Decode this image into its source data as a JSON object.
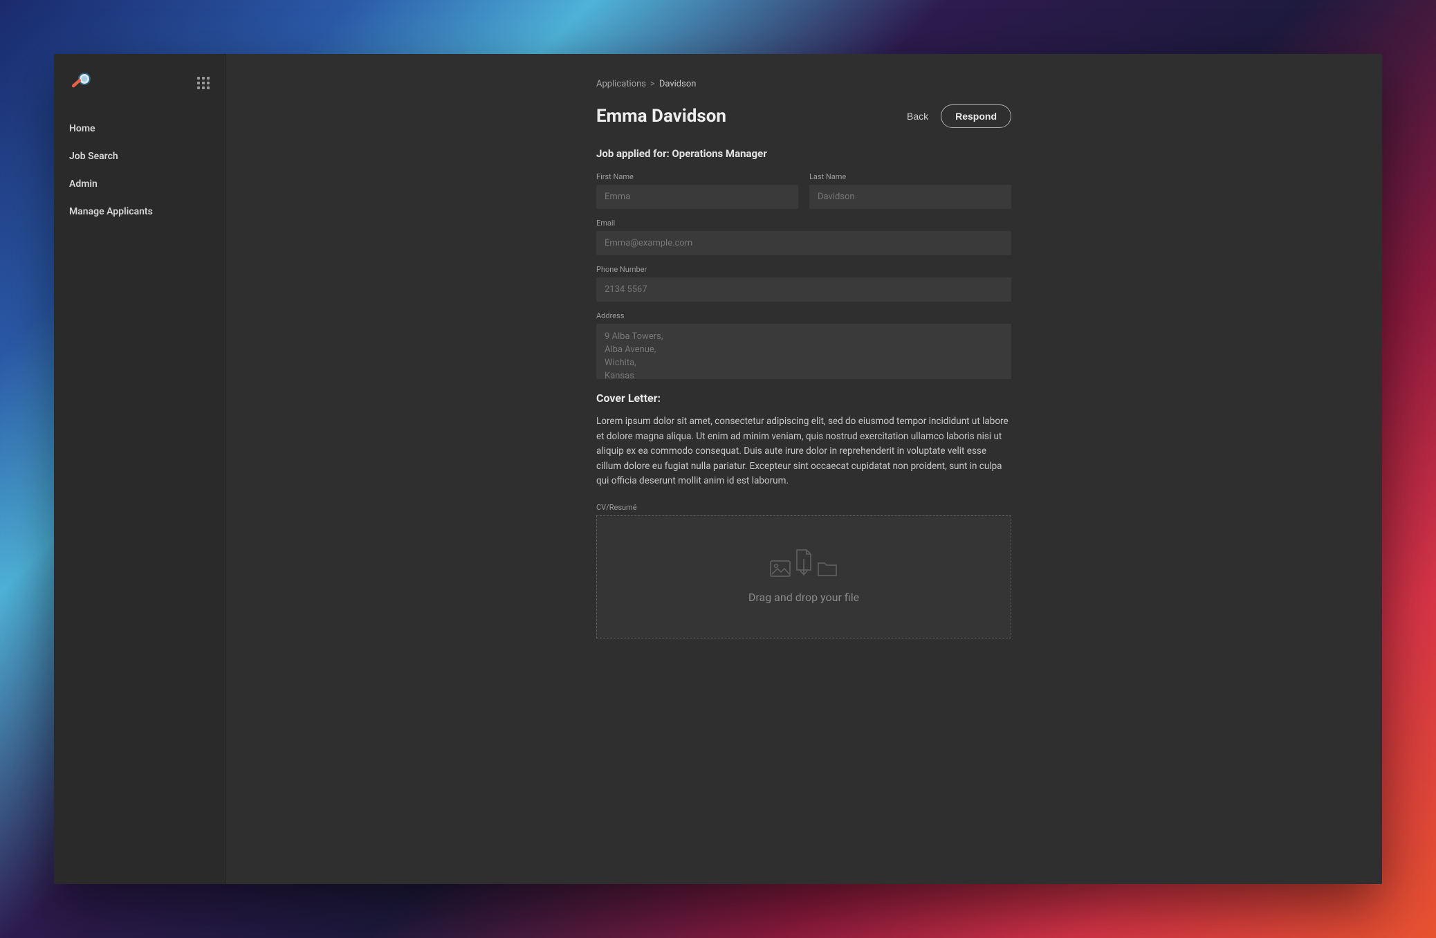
{
  "sidebar": {
    "nav_items": [
      "Home",
      "Job Search",
      "Admin",
      "Manage Applicants"
    ]
  },
  "breadcrumb": {
    "parent": "Applications",
    "separator": ">",
    "current": "Davidson"
  },
  "header": {
    "title": "Emma Davidson",
    "back_label": "Back",
    "respond_label": "Respond"
  },
  "job": {
    "prefix": "Job applied for: ",
    "title": "Operations Manager"
  },
  "form": {
    "first_name": {
      "label": "First Name",
      "value": "Emma"
    },
    "last_name": {
      "label": "Last Name",
      "value": "Davidson"
    },
    "email": {
      "label": "Email",
      "value": "Emma@example.com"
    },
    "phone": {
      "label": "Phone Number",
      "value": "2134 5567"
    },
    "address": {
      "label": "Address",
      "value": "9 Alba Towers,\nAlba Avenue,\nWichita,\nKansas"
    }
  },
  "cover_letter": {
    "title": "Cover Letter:",
    "body": "Lorem ipsum dolor sit amet, consectetur adipiscing elit, sed do eiusmod tempor incididunt ut labore et dolore magna aliqua. Ut enim ad minim veniam, quis nostrud exercitation ullamco laboris nisi ut aliquip ex ea commodo consequat. Duis aute irure dolor in reprehenderit in voluptate velit esse cillum dolore eu fugiat nulla pariatur. Excepteur sint occaecat cupidatat non proident, sunt in culpa qui officia deserunt mollit anim id est laborum."
  },
  "cv": {
    "label": "CV/Resumé",
    "drop_text": "Drag and drop your file"
  }
}
